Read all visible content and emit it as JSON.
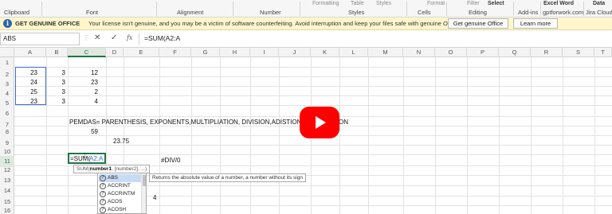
{
  "ribbon": {
    "groups": [
      "Clipboard",
      "Font",
      "Alignment",
      "Number",
      "Styles",
      "Cells",
      "Editing",
      "Add-ins",
      "gptforwork.com",
      "Jira Cloud"
    ],
    "top_items": [
      "Formatting",
      "Table",
      "Styles",
      "Format",
      "Filter",
      "Select",
      "Excel Word",
      "Data"
    ]
  },
  "warning": {
    "icon": "info-icon",
    "title": "GET GENUINE OFFICE",
    "message": "Your license isn't genuine, and you may be a victim of software counterfeiting. Avoid interruption and keep your files safe with genuine Office today.",
    "primary_button": "Get genuine Office",
    "secondary_button": "Learn more"
  },
  "formula_bar": {
    "name_box": "ABS",
    "cancel_symbol": "✕",
    "enter_symbol": "✓",
    "fx_label": "fx",
    "formula": "=SUM(A2:A"
  },
  "columns": [
    "A",
    "B",
    "C",
    "D",
    "E",
    "F",
    "G",
    "H",
    "I",
    "J",
    "K",
    "L",
    "M",
    "N",
    "O",
    "P",
    "Q",
    "R",
    "S",
    "T"
  ],
  "rows": [
    "1",
    "2",
    "3",
    "4",
    "5",
    "6",
    "7",
    "8",
    "9",
    "10",
    "11",
    "12",
    "13",
    "14",
    "15",
    "16"
  ],
  "cells": {
    "a2": "23",
    "b2": "3",
    "c2": "12",
    "a3": "24",
    "b3": "3",
    "c3": "23",
    "a4": "25",
    "b4": "3",
    "c4": "2",
    "a5": "23",
    "b5": "3",
    "c5": "4",
    "c7": "PEMDAS= PARENTHESIS, EXPONENTS,MULTIPLIATION, DIVISION,ADISTION AND",
    "c7_tail": "ON",
    "c8": "59",
    "d9": "23.75",
    "c11_prefix": "=SUM(",
    "c11_ref": "A2:A",
    "f11": "#DIV/0",
    "d14": "4"
  },
  "tooltip": {
    "function": "SUM(",
    "arg1": "number1",
    "rest": ", [number2], ...)"
  },
  "autocomplete": [
    "ABS",
    "ACCRINT",
    "ACCRINTM",
    "ACOS",
    "ACOSH"
  ],
  "autocomplete_description": "Returns the absolute value of a number, a number without its sign",
  "colors": {
    "accent": "#217346",
    "warning_bg": "#fff6cc",
    "play_button": "#ff0000",
    "range_border": "#3b6cd1"
  }
}
